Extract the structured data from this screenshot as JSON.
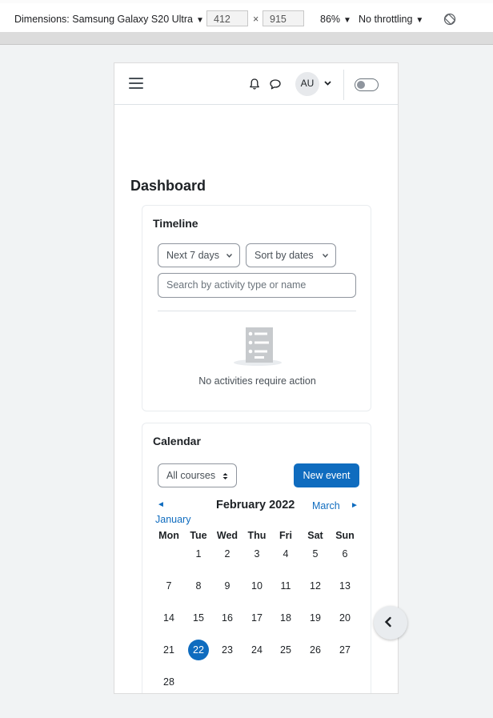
{
  "devtools": {
    "device_label": "Dimensions: Samsung Galaxy S20 Ultra",
    "width": "412",
    "times": "×",
    "height": "915",
    "zoom": "86%",
    "throttling": "No throttling",
    "icons": {
      "rotate": "rotate-icon",
      "caret": "caret-down-icon"
    }
  },
  "navbar": {
    "avatar_initials": "AU",
    "icons": [
      "menu-icon",
      "bell-icon",
      "chat-icon",
      "chevron-down-icon",
      "toggle-switch"
    ]
  },
  "page": {
    "title": "Dashboard"
  },
  "timeline": {
    "title": "Timeline",
    "filter_label": "Next 7 days",
    "sort_label": "Sort by dates",
    "search_placeholder": "Search by activity type or name",
    "empty_message": "No activities require action"
  },
  "calendar": {
    "title": "Calendar",
    "course_filter": "All courses",
    "new_event_label": "New event",
    "prev_arrow": "◄",
    "prev_month": "January",
    "current_month": "February 2022",
    "next_month": "March",
    "next_arrow": "►",
    "weekdays": [
      "Mon",
      "Tue",
      "Wed",
      "Thu",
      "Fri",
      "Sat",
      "Sun"
    ],
    "weeks": [
      [
        "",
        "1",
        "2",
        "3",
        "4",
        "5",
        "6"
      ],
      [
        "7",
        "8",
        "9",
        "10",
        "11",
        "12",
        "13"
      ],
      [
        "14",
        "15",
        "16",
        "17",
        "18",
        "19",
        "20"
      ],
      [
        "21",
        "22",
        "23",
        "24",
        "25",
        "26",
        "27"
      ],
      [
        "28",
        "",
        "",
        "",
        "",
        "",
        ""
      ]
    ],
    "today": "22"
  },
  "colors": {
    "primary": "#0f6cbf",
    "text": "#1d2125",
    "border": "#dee2e6"
  }
}
